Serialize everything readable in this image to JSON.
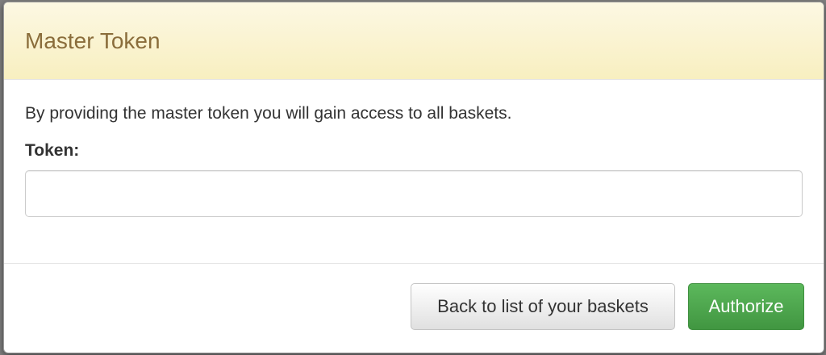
{
  "dialog": {
    "title": "Master Token",
    "description": "By providing the master token you will gain access to all baskets.",
    "token_label": "Token:",
    "token_value": "",
    "token_placeholder": ""
  },
  "footer": {
    "back_button_label": "Back to list of your baskets",
    "authorize_button_label": "Authorize"
  },
  "colors": {
    "header_background": "#fcf8e3",
    "title_color": "#8a6d3b",
    "authorize_button": "#5cb85c"
  }
}
